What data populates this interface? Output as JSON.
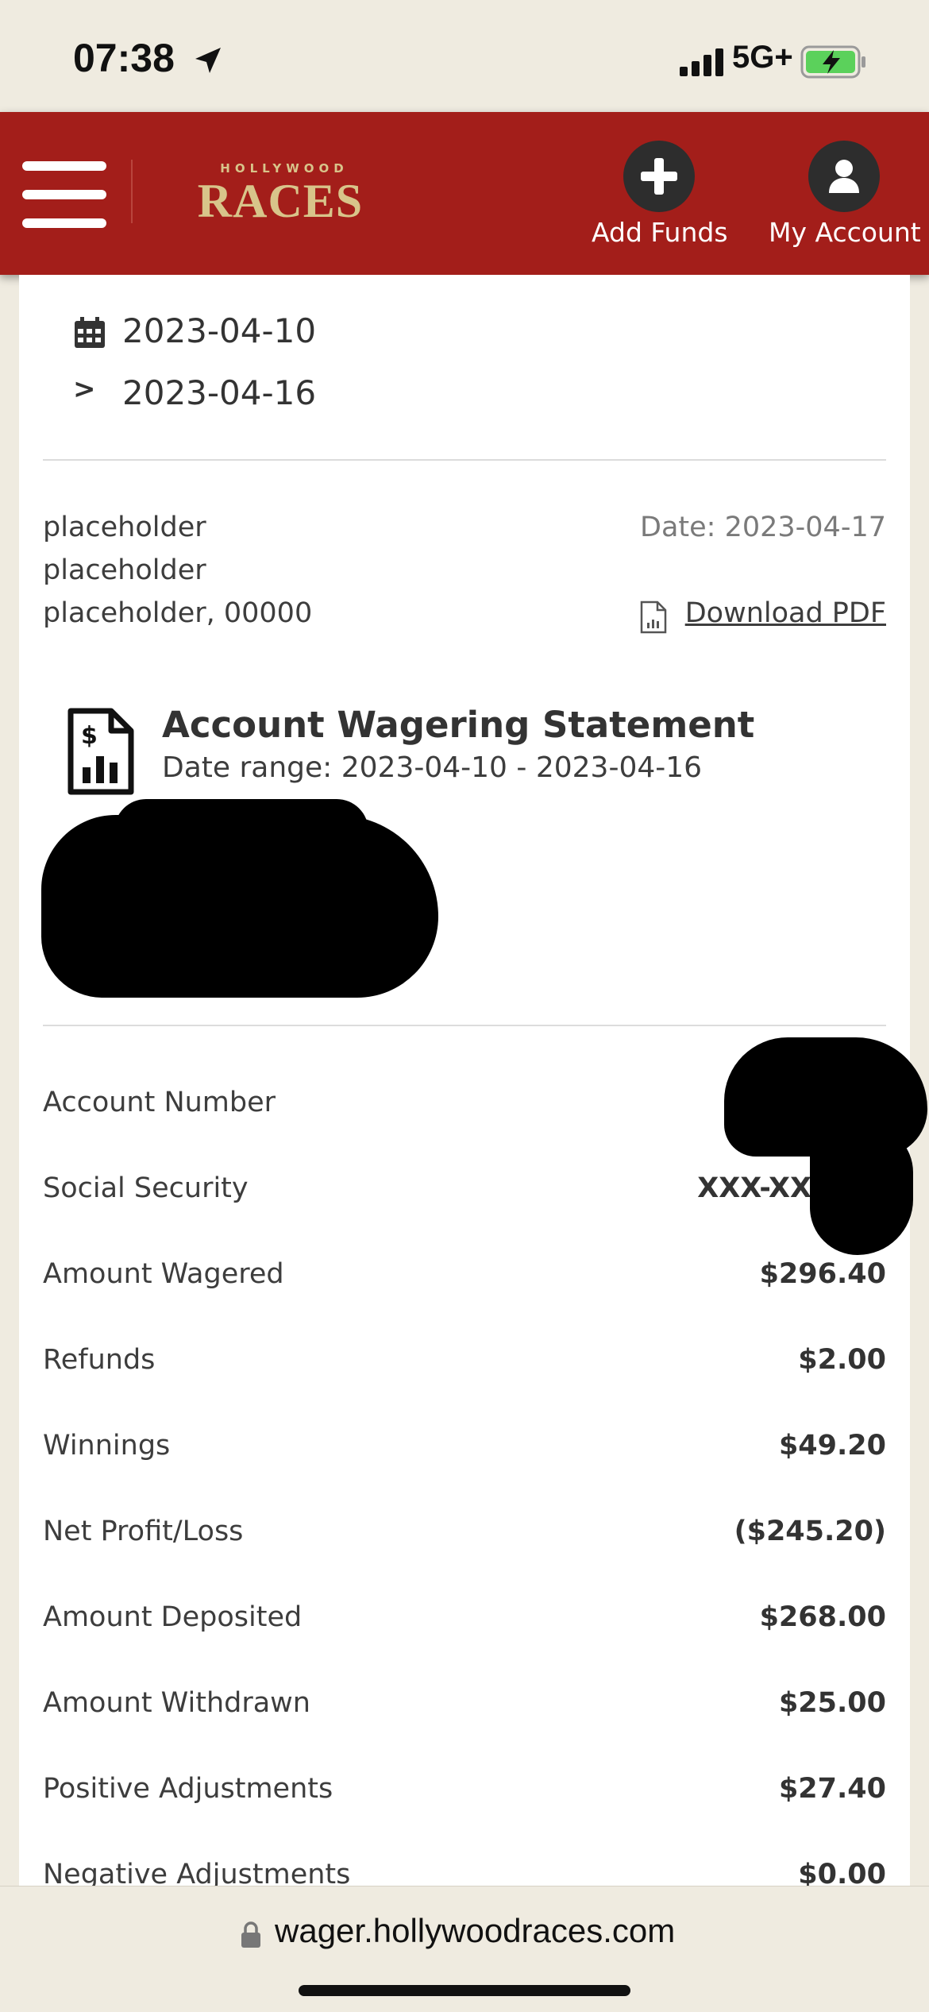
{
  "status_bar": {
    "time": "07:38",
    "network": "5G+",
    "icons": [
      "location-arrow-icon",
      "signal-bars-icon",
      "battery-charging-icon"
    ]
  },
  "header": {
    "logo_small": "HOLLYWOOD",
    "logo_main": "RACES",
    "add_funds_label": "Add Funds",
    "my_account_label": "My Account",
    "colors": {
      "header_bg": "#a31e1a",
      "logo_gold": "#d8c48a"
    }
  },
  "date_filter": {
    "start": "2023-04-10",
    "end": "2023-04-16",
    "separator": ">"
  },
  "address": {
    "line1": "placeholder",
    "line2": "placeholder",
    "line3": "placeholder, 00000"
  },
  "statement": {
    "date": "Date: 2023-04-17",
    "download_label": "Download PDF",
    "title": "Account Wagering Statement",
    "range": "Date range: 2023-04-10 - 2023-04-16"
  },
  "summary": [
    {
      "label": "Account Number",
      "value": ""
    },
    {
      "label": "Social Security",
      "value": "XXX-XX"
    },
    {
      "label": "Amount Wagered",
      "value": "$296.40"
    },
    {
      "label": "Refunds",
      "value": "$2.00"
    },
    {
      "label": "Winnings",
      "value": "$49.20"
    },
    {
      "label": "Net Profit/Loss",
      "value": "($245.20)"
    },
    {
      "label": "Amount Deposited",
      "value": "$268.00"
    },
    {
      "label": "Amount Withdrawn",
      "value": "$25.00"
    },
    {
      "label": "Positive Adjustments",
      "value": "$27.40"
    },
    {
      "label": "Negative Adjustments",
      "value": "$0.00"
    }
  ],
  "browser": {
    "url": "wager.hollywoodraces.com"
  }
}
